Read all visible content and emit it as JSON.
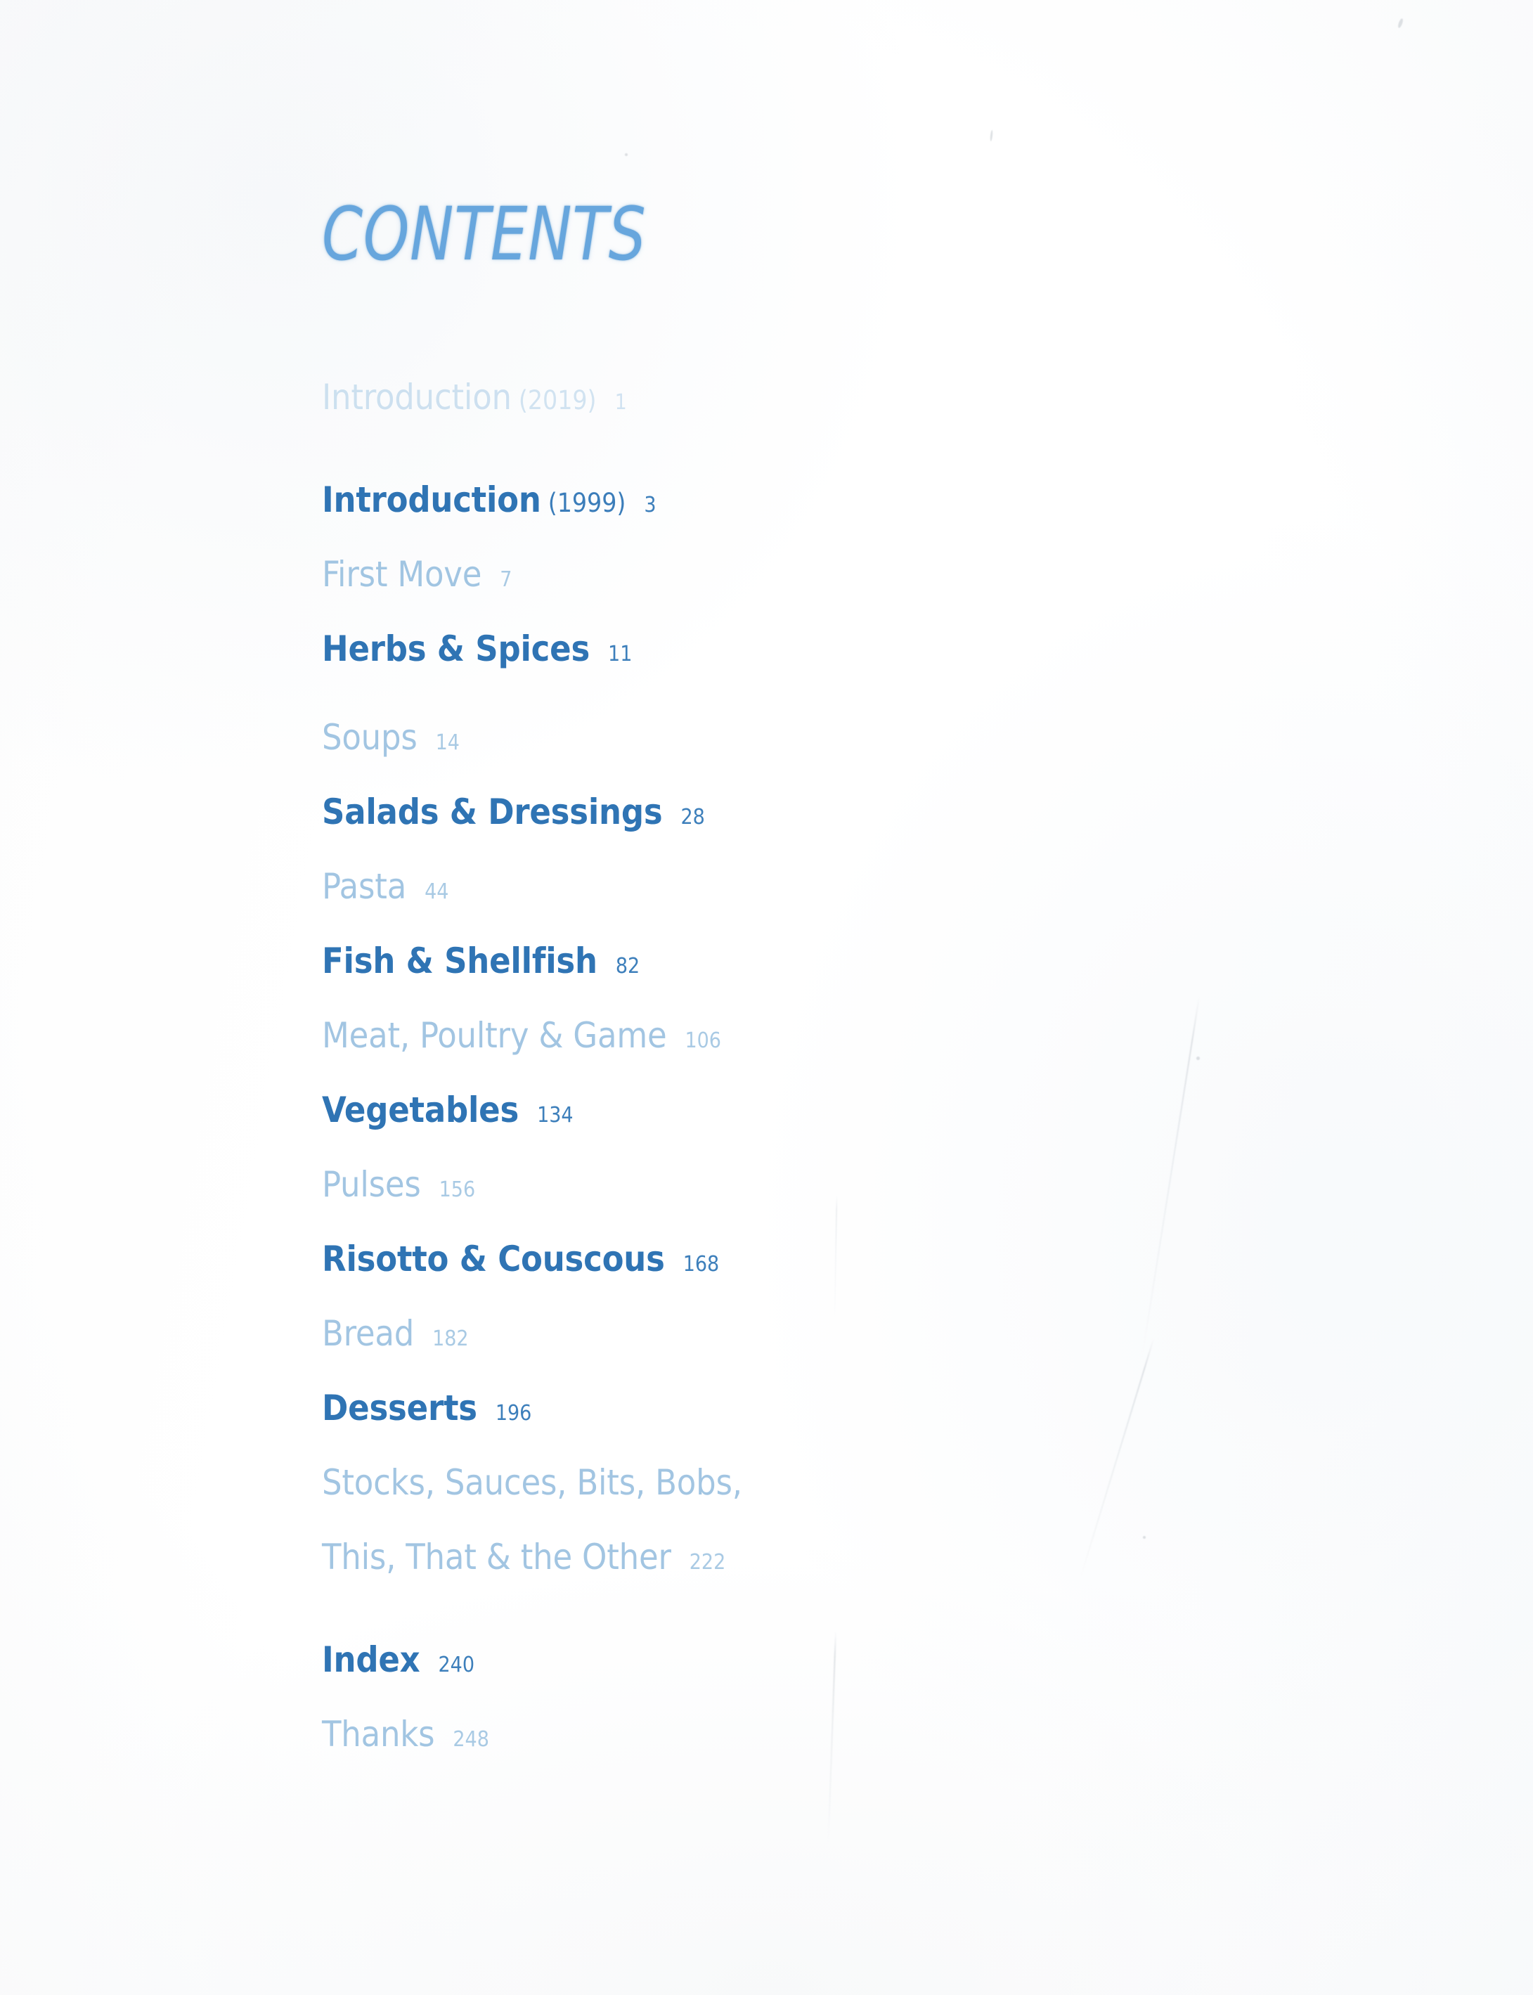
{
  "page": {
    "title": "CONTENTS",
    "background_color": "#ffffff",
    "ink_color_strong": "#2f74b4",
    "ink_color_faded": "#7fb0d8",
    "ink_color_ghost": "#a9cbe6",
    "title_color": "#67a6dd"
  },
  "groups": [
    {
      "entries": [
        {
          "label": "Introduction",
          "year": "(2019)",
          "page": "1",
          "ink": "ghost"
        }
      ]
    },
    {
      "entries": [
        {
          "label": "Introduction",
          "year": "(1999)",
          "page": "3",
          "ink": "strong"
        },
        {
          "label": "First Move",
          "year": "",
          "page": "7",
          "ink": "faded"
        },
        {
          "label": "Herbs & Spices",
          "year": "",
          "page": "11",
          "ink": "strong"
        }
      ]
    },
    {
      "entries": [
        {
          "label": "Soups",
          "year": "",
          "page": "14",
          "ink": "faded"
        },
        {
          "label": "Salads & Dressings",
          "year": "",
          "page": "28",
          "ink": "strong"
        },
        {
          "label": "Pasta",
          "year": "",
          "page": "44",
          "ink": "faded"
        },
        {
          "label": "Fish & Shellfish",
          "year": "",
          "page": "82",
          "ink": "strong"
        },
        {
          "label": "Meat, Poultry & Game",
          "year": "",
          "page": "106",
          "ink": "faded"
        },
        {
          "label": "Vegetables",
          "year": "",
          "page": "134",
          "ink": "strong"
        },
        {
          "label": "Pulses",
          "year": "",
          "page": "156",
          "ink": "faded"
        },
        {
          "label": "Risotto & Couscous",
          "year": "",
          "page": "168",
          "ink": "strong"
        },
        {
          "label": "Bread",
          "year": "",
          "page": "182",
          "ink": "faded"
        },
        {
          "label": "Desserts",
          "year": "",
          "page": "196",
          "ink": "strong"
        },
        {
          "label": "Stocks, Sauces, Bits, Bobs,",
          "year": "",
          "page": "",
          "ink": "faded"
        },
        {
          "label": "This, That & the Other",
          "year": "",
          "page": "222",
          "ink": "faded"
        }
      ]
    },
    {
      "entries": [
        {
          "label": "Index",
          "year": "",
          "page": "240",
          "ink": "strong"
        },
        {
          "label": "Thanks",
          "year": "",
          "page": "248",
          "ink": "faded"
        }
      ]
    }
  ]
}
